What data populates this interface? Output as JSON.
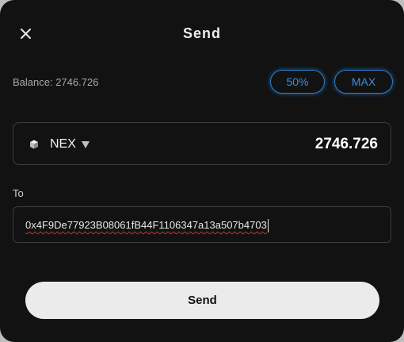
{
  "header": {
    "title": "Send",
    "close_icon": "close-icon"
  },
  "balance": {
    "text": "Balance: 2746.726"
  },
  "quick_amounts": {
    "half_label": "50%",
    "max_label": "MAX",
    "accent_color": "#2a7fd0"
  },
  "amount": {
    "token_icon": "cube-icon",
    "token_name": "NEX",
    "dropdown_icon": "caret-down-icon",
    "value": "2746.726"
  },
  "recipient": {
    "label": "To",
    "address": "0x4F9De77923B08061fB44F1106347a13a507b4703"
  },
  "actions": {
    "send_label": "Send"
  }
}
